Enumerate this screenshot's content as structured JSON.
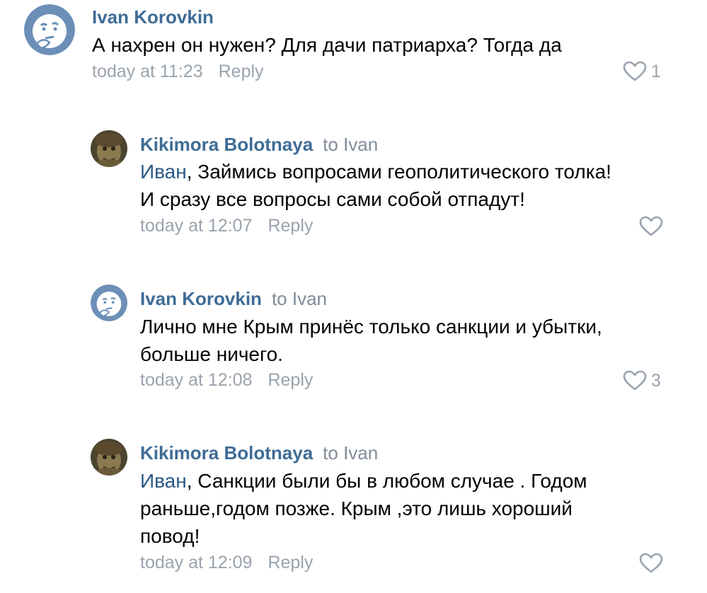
{
  "colors": {
    "author": "#3e6c96",
    "mention": "#2a5885",
    "meta": "#9aa3ad",
    "text": "#000000",
    "avatar_blue": "#6c8fb8"
  },
  "comments": [
    {
      "author": "Ivan Korovkin",
      "to": "",
      "mention": "",
      "lines": [
        "А нахрен он нужен? Для дачи патриарха? Тогда да"
      ],
      "time": "today at 11:23",
      "reply_label": "Reply",
      "likes": "1",
      "avatar_icon": "thinking-face-icon"
    },
    {
      "author": "Kikimora Bolotnaya",
      "to": "to Ivan",
      "mention": "Иван",
      "lines": [
        ", Займись вопросами геополитического толка!",
        "И сразу все вопросы сами собой отпадут!"
      ],
      "time": "today at 12:07",
      "reply_label": "Reply",
      "likes": "",
      "avatar_icon": "kikimora-photo"
    },
    {
      "author": "Ivan Korovkin",
      "to": "to Ivan",
      "mention": "",
      "lines": [
        "Лично мне Крым принёс только санкции и убытки,",
        "больше ничего."
      ],
      "time": "today at 12:08",
      "reply_label": "Reply",
      "likes": "3",
      "avatar_icon": "thinking-face-icon"
    },
    {
      "author": "Kikimora Bolotnaya",
      "to": "to Ivan",
      "mention": "Иван",
      "lines": [
        ", Санкции были бы в любом случае . Годом",
        "раньше,годом позже. Крым ,это лишь хороший",
        "повод!"
      ],
      "time": "today at 12:09",
      "reply_label": "Reply",
      "likes": "",
      "avatar_icon": "kikimora-photo"
    }
  ]
}
